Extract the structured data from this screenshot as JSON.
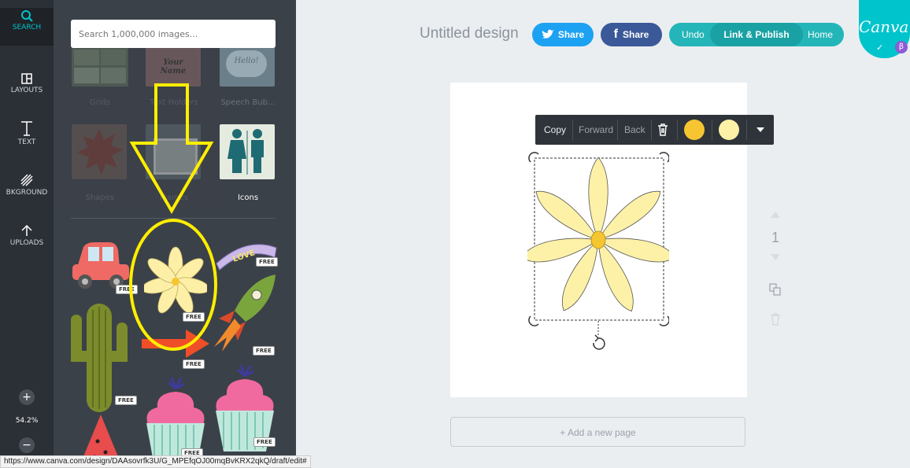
{
  "rail": {
    "items": [
      {
        "label": "SEARCH",
        "icon": "search-icon"
      },
      {
        "label": "LAYOUTS",
        "icon": "layouts-icon"
      },
      {
        "label": "TEXT",
        "icon": "text-icon"
      },
      {
        "label": "BKGROUND",
        "icon": "background-icon"
      },
      {
        "label": "UPLOADS",
        "icon": "upload-icon"
      }
    ],
    "zoom_level": "54.2%",
    "zoom_in": "+",
    "zoom_out": "−"
  },
  "search": {
    "placeholder": "Search 1,000,000 images..."
  },
  "categories": {
    "top_row": [
      "Grids",
      "Text Holders",
      "Speech Bub..."
    ],
    "bottom_row": [
      "Shapes",
      "Frames",
      "Icons"
    ],
    "text_holder_sample": "Your Name",
    "speech_sample": "Hello!"
  },
  "free_badge": "FREE",
  "love_banner": "LOVE",
  "header": {
    "title": "Untitled design",
    "twitter_share": "Share",
    "facebook_share": "Share",
    "undo": "Undo",
    "link_publish": "Link & Publish",
    "home": "Home",
    "logo": "Canva",
    "beta_badge": "β",
    "check_mark": "✓"
  },
  "toolbar": {
    "copy": "Copy",
    "forward": "Forward",
    "back": "Back",
    "color1": "#f7c531",
    "color2": "#fdf1a8"
  },
  "page_controls": {
    "page_number": "1"
  },
  "add_page": "+ Add a new page",
  "status_url": "https://www.canva.com/design/DAAsovrfk3U/G_MPEfqOJ00mqBvKRX2qkQ/draft/edit#",
  "colors": {
    "accent": "#00c4cc",
    "twitter": "#1da1f2",
    "facebook": "#3b5998",
    "annotation": "#ffee00"
  }
}
